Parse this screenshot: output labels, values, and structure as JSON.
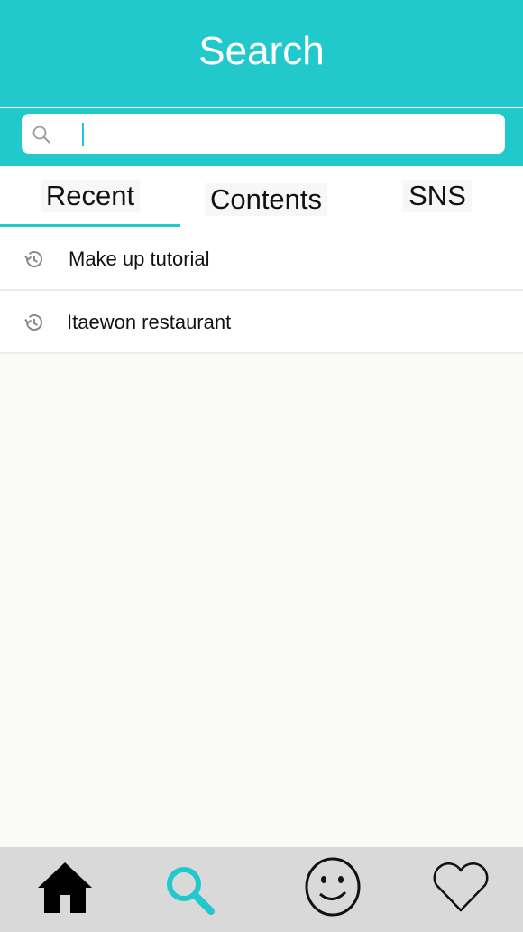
{
  "header": {
    "title": "Search"
  },
  "search": {
    "value": "",
    "placeholder": ""
  },
  "tabs": [
    {
      "label": "Recent",
      "active": true
    },
    {
      "label": "Contents",
      "active": false
    },
    {
      "label": "SNS",
      "active": false
    }
  ],
  "recent_searches": [
    {
      "label": "Make up tutorial",
      "icon": "history-icon"
    },
    {
      "label": "Itaewon restaurant",
      "icon": "history-icon"
    }
  ],
  "bottom_nav": [
    {
      "icon": "home-icon",
      "active": false
    },
    {
      "icon": "search-icon",
      "active": true
    },
    {
      "icon": "smiley-face-icon",
      "active": false
    },
    {
      "icon": "heart-icon",
      "active": false
    }
  ],
  "colors": {
    "accent": "#22c9cc",
    "nav_background": "#d9d9d9",
    "page_background": "#fafaf9"
  }
}
